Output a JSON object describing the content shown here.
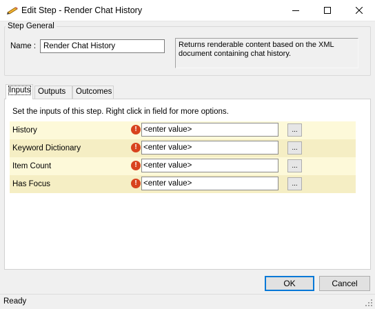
{
  "window": {
    "title": "Edit Step - Render Chat History",
    "app_icon": "pencil-icon",
    "controls": [
      "minimize-icon",
      "maximize-icon",
      "close-icon"
    ]
  },
  "step_general": {
    "legend": "Step General",
    "name_label": "Name :",
    "name_value": "Render Chat History",
    "description": "Returns renderable content based on the XML document containing chat history."
  },
  "tabs": [
    {
      "label": "Inputs",
      "active": true
    },
    {
      "label": "Outputs",
      "active": false
    },
    {
      "label": "Outcomes",
      "active": false
    }
  ],
  "inputs": {
    "instructions": "Set the inputs of this step.  Right click in field for more options.",
    "rows": [
      {
        "label": "History",
        "value": "<enter value>",
        "button": "..."
      },
      {
        "label": "Keyword Dictionary",
        "value": "<enter value>",
        "button": "..."
      },
      {
        "label": "Item Count",
        "value": "<enter value>",
        "button": "..."
      },
      {
        "label": "Has Focus",
        "value": "<enter value>",
        "button": "..."
      }
    ],
    "error_icon": "error-icon",
    "error_color": "#d8431e"
  },
  "buttons": {
    "ok": "OK",
    "cancel": "Cancel"
  },
  "status": {
    "text": "Ready"
  },
  "colors": {
    "row_odd": "#fdf9d9",
    "row_even": "#f5eec4",
    "accent": "#0078d7"
  }
}
